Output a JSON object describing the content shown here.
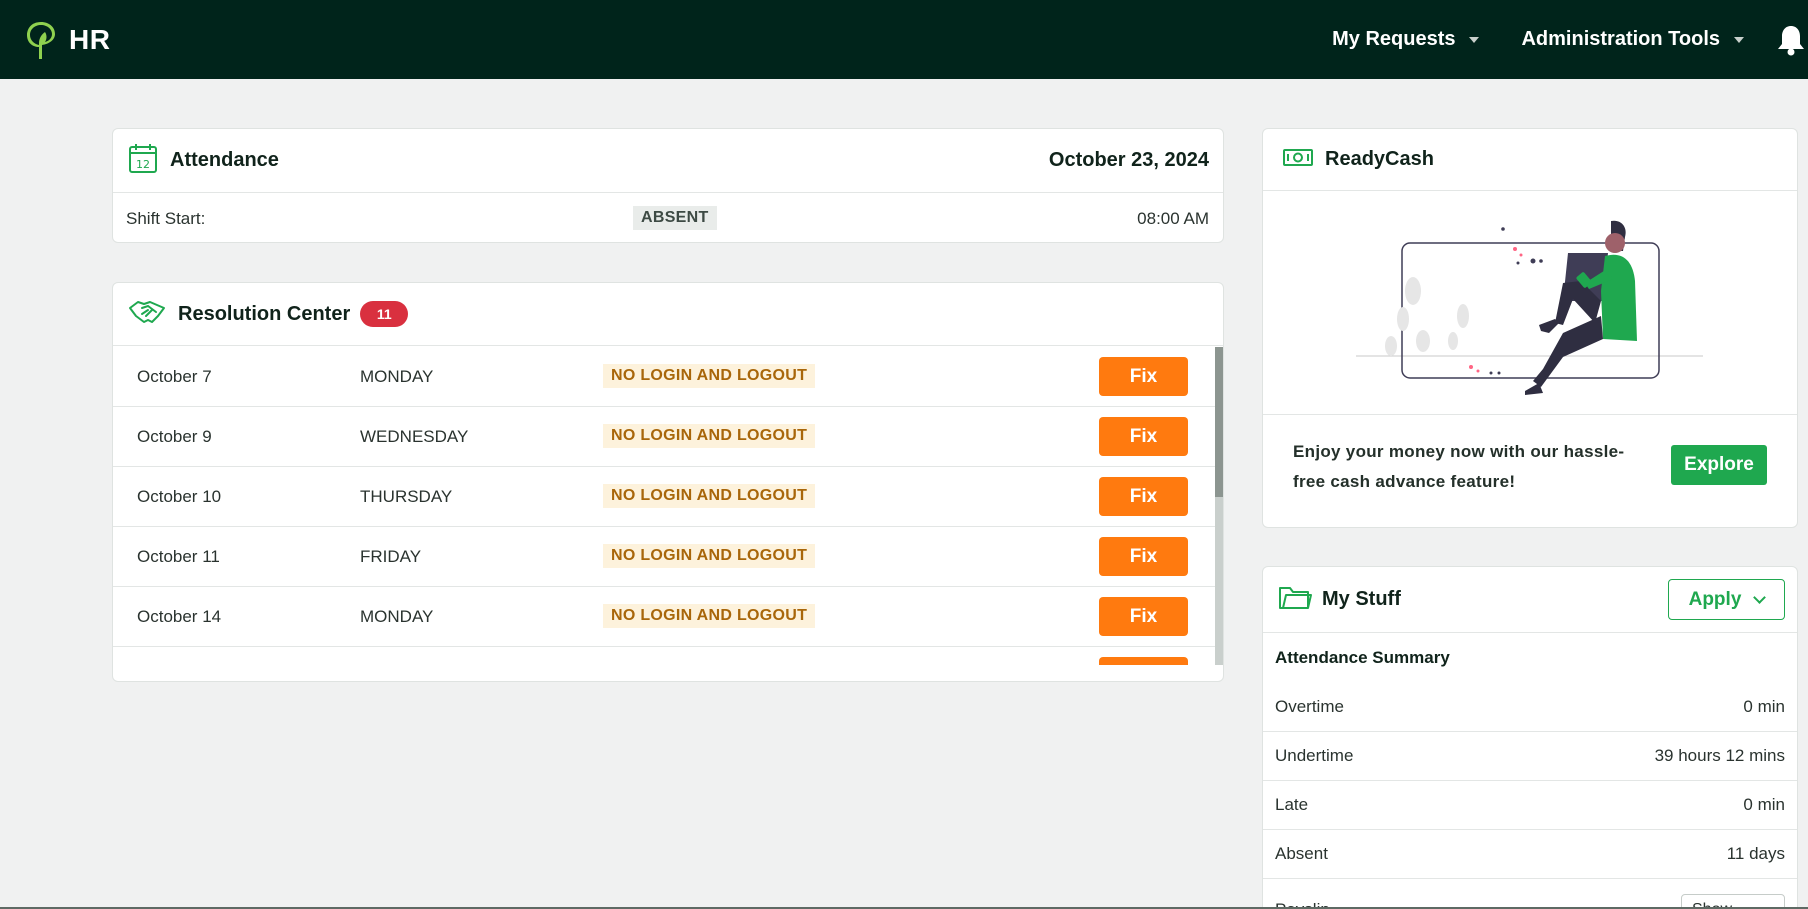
{
  "app": {
    "brand": "HR"
  },
  "nav": {
    "my_requests": "My Requests",
    "admin_tools": "Administration Tools"
  },
  "attendance": {
    "title": "Attendance",
    "date": "October 23, 2024",
    "shift_label": "Shift Start:",
    "status": "ABSENT",
    "time": "08:00 AM"
  },
  "resolution": {
    "title": "Resolution Center",
    "count": "11",
    "rows": [
      {
        "date": "October 7",
        "day": "MONDAY",
        "issue": "NO LOGIN AND LOGOUT",
        "action": "Fix"
      },
      {
        "date": "October 9",
        "day": "WEDNESDAY",
        "issue": "NO LOGIN AND LOGOUT",
        "action": "Fix"
      },
      {
        "date": "October 10",
        "day": "THURSDAY",
        "issue": "NO LOGIN AND LOGOUT",
        "action": "Fix"
      },
      {
        "date": "October 11",
        "day": "FRIDAY",
        "issue": "NO LOGIN AND LOGOUT",
        "action": "Fix"
      },
      {
        "date": "October 14",
        "day": "MONDAY",
        "issue": "NO LOGIN AND LOGOUT",
        "action": "Fix"
      },
      {
        "date": "",
        "day": "",
        "issue": "",
        "action": ""
      }
    ]
  },
  "readycash": {
    "title": "ReadyCash",
    "text": "Enjoy your money now with our hassle-free cash advance feature!",
    "button": "Explore"
  },
  "mystuff": {
    "title": "My Stuff",
    "apply": "Apply",
    "summary_title": "Attendance Summary",
    "rows": [
      {
        "label": "Overtime",
        "value": "0 min"
      },
      {
        "label": "Undertime",
        "value": "39 hours 12 mins"
      },
      {
        "label": "Late",
        "value": "0 min"
      },
      {
        "label": "Absent",
        "value": "11 days"
      }
    ],
    "partial_label": "Payslip",
    "partial_button": "Show"
  },
  "colors": {
    "topbar": "#00241b",
    "accent_green": "#1fa84f",
    "fix_orange": "#ff7a0f",
    "badge_red": "#d9303f"
  },
  "icons": [
    "leaf-logo-icon",
    "chevron-down-icon",
    "bell-icon",
    "calendar-icon",
    "handshake-icon",
    "cash-icon",
    "folder-icon"
  ]
}
